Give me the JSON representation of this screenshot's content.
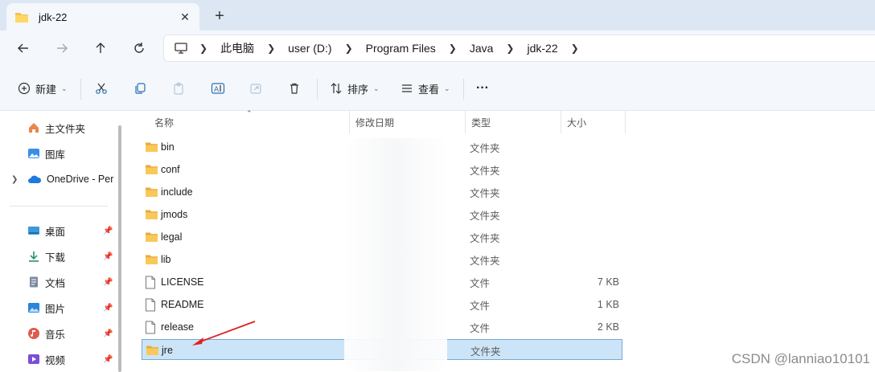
{
  "tab": {
    "title": "jdk-22",
    "close": "✕",
    "new_tab": "+"
  },
  "address": {
    "crumbs": [
      "此电脑",
      "user (D:)",
      "Program Files",
      "Java",
      "jdk-22"
    ]
  },
  "toolbar": {
    "new_label": "新建",
    "sort_label": "排序",
    "view_label": "查看",
    "more_label": "···"
  },
  "sidebar": {
    "items": [
      {
        "label": "主文件夹",
        "icon": "home-icon"
      },
      {
        "label": "图库",
        "icon": "gallery-icon"
      },
      {
        "label": "OneDrive - Per",
        "icon": "onedrive-icon"
      },
      {
        "label": "桌面",
        "icon": "desktop-icon"
      },
      {
        "label": "下载",
        "icon": "download-icon"
      },
      {
        "label": "文档",
        "icon": "documents-icon"
      },
      {
        "label": "图片",
        "icon": "pictures-icon"
      },
      {
        "label": "音乐",
        "icon": "music-icon"
      },
      {
        "label": "视频",
        "icon": "videos-icon"
      }
    ]
  },
  "columns": {
    "name": "名称",
    "modified": "修改日期",
    "type": "类型",
    "size": "大小"
  },
  "files": [
    {
      "name": "bin",
      "kind": "folder",
      "type": "文件夹",
      "size": ""
    },
    {
      "name": "conf",
      "kind": "folder",
      "type": "文件夹",
      "size": ""
    },
    {
      "name": "include",
      "kind": "folder",
      "type": "文件夹",
      "size": ""
    },
    {
      "name": "jmods",
      "kind": "folder",
      "type": "文件夹",
      "size": ""
    },
    {
      "name": "legal",
      "kind": "folder",
      "type": "文件夹",
      "size": ""
    },
    {
      "name": "lib",
      "kind": "folder",
      "type": "文件夹",
      "size": ""
    },
    {
      "name": "LICENSE",
      "kind": "file",
      "type": "文件",
      "size": "7 KB"
    },
    {
      "name": "README",
      "kind": "file",
      "type": "文件",
      "size": "1 KB"
    },
    {
      "name": "release",
      "kind": "file",
      "type": "文件",
      "size": "2 KB"
    },
    {
      "name": "jre",
      "kind": "folder",
      "type": "文件夹",
      "size": ""
    }
  ],
  "watermark": "CSDN @lanniao10101",
  "colors": {
    "folder": "#f4c14d",
    "selection": "#cce4f7",
    "annotation_arrow": "#e02020"
  }
}
